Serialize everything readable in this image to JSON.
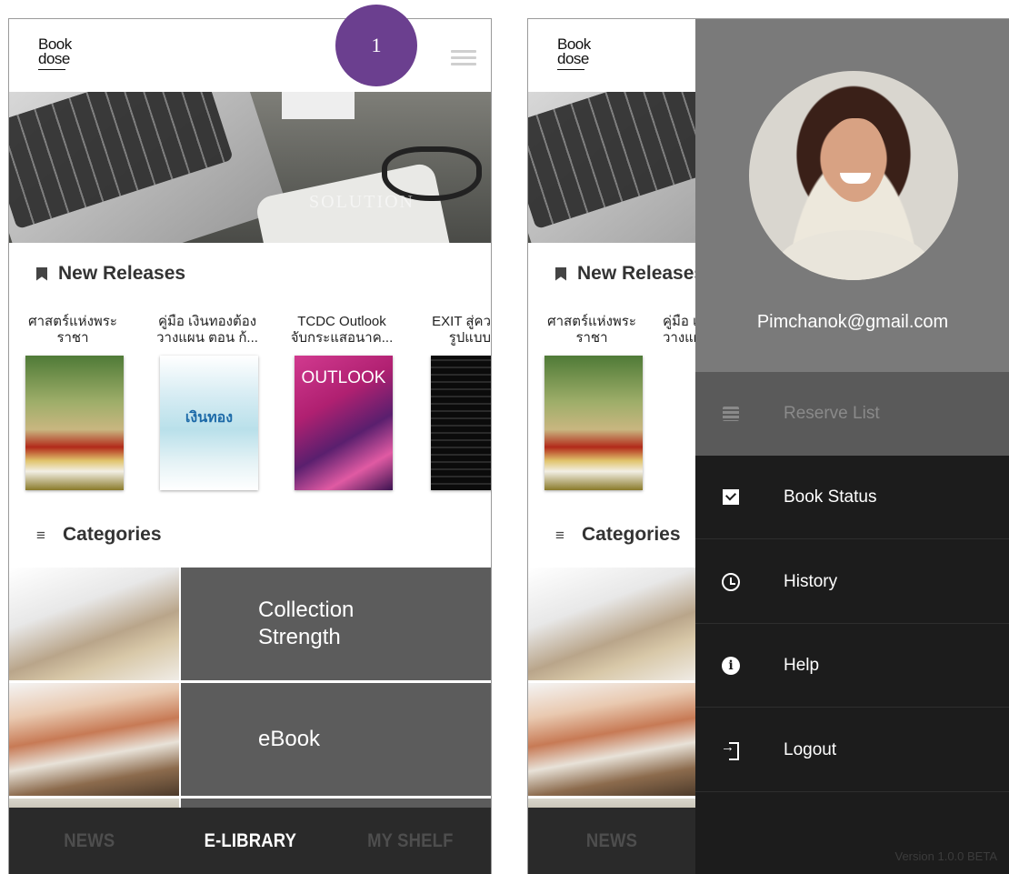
{
  "step_badge": "1",
  "app": {
    "logo_line1": "Book",
    "logo_line2": "dose"
  },
  "banner": {
    "watermark": "SOLUTION"
  },
  "sections": {
    "new_releases": "New Releases",
    "categories": "Categories"
  },
  "books": [
    {
      "title_line1": "ศาสตร์แห่งพระ",
      "title_line2": "ราชา"
    },
    {
      "title_line1": "คู่มือ เงินทองต้อง",
      "title_line2": "วางแผน ตอน ก้..."
    },
    {
      "title_line1": "TCDC Outlook",
      "title_line2": "จับกระแสอนาค..."
    },
    {
      "title_line1": "EXIT สู่คว",
      "title_line2": "รูปแบบ"
    }
  ],
  "covers": {
    "book2_label": "เงินทอง",
    "book3_label": "OUTLOOK"
  },
  "category_panels": [
    {
      "line1": "Collection",
      "line2": "Strength"
    },
    {
      "line1": "eBook",
      "line2": ""
    }
  ],
  "bottom_nav": {
    "news": "NEWS",
    "elibrary": "E-LIBRARY",
    "myshelf": "MY SHELF"
  },
  "drawer": {
    "email": "Pimchanok@gmail.com",
    "items": [
      {
        "label": "Reserve List",
        "icon": "notepad-icon",
        "enabled": false
      },
      {
        "label": "Book Status",
        "icon": "check-icon",
        "enabled": true
      },
      {
        "label": "History",
        "icon": "history-icon",
        "enabled": true
      },
      {
        "label": "Help",
        "icon": "info-icon",
        "enabled": true
      },
      {
        "label": "Logout",
        "icon": "logout-icon",
        "enabled": true
      }
    ],
    "version": "Version 1.0.0 BETA"
  },
  "colors": {
    "badge": "#6b3f8f",
    "nav_bg": "#2a2a2a",
    "drawer_bg": "#1c1c1c",
    "category_panel": "#5c5c5c"
  }
}
